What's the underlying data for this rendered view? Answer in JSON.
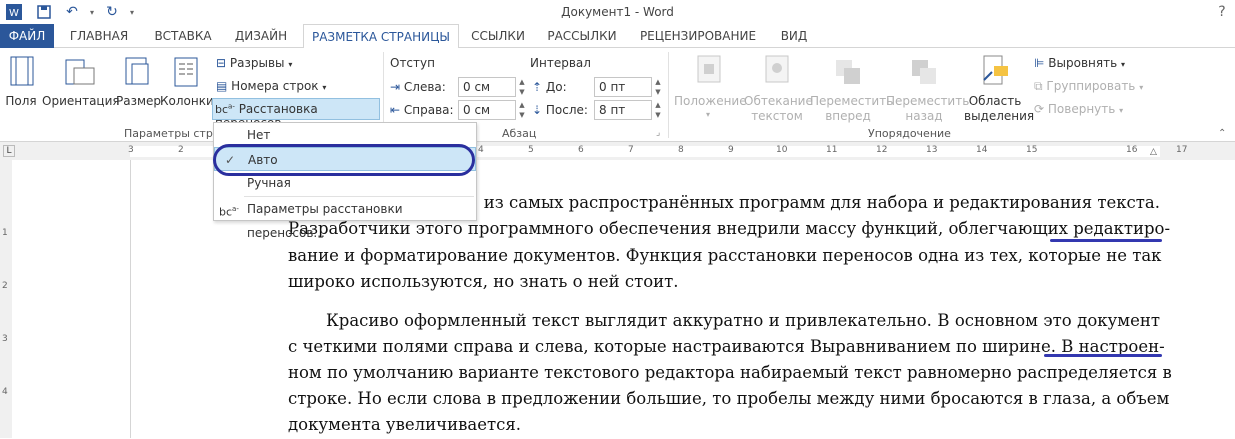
{
  "window": {
    "title": "Документ1 - Word"
  },
  "quick_access": {
    "save_icon": "save-icon",
    "undo_icon": "undo-icon",
    "redo_icon": "redo-icon"
  },
  "tabs": [
    {
      "label": "ФАЙЛ"
    },
    {
      "label": "ГЛАВНАЯ"
    },
    {
      "label": "ВСТАВКА"
    },
    {
      "label": "ДИЗАЙН"
    },
    {
      "label": "РАЗМЕТКА СТРАНИЦЫ"
    },
    {
      "label": "ССЫЛКИ"
    },
    {
      "label": "РАССЫЛКИ"
    },
    {
      "label": "РЕЦЕНЗИРОВАНИЕ"
    },
    {
      "label": "ВИД"
    }
  ],
  "page_setup": {
    "group_label": "Параметры стра",
    "margins": "Поля",
    "orientation": "Ориентация",
    "size": "Размер",
    "columns": "Колонки",
    "breaks": "Разрывы",
    "line_numbers": "Номера строк",
    "hyphenation": "Расстановка переносов"
  },
  "paragraph": {
    "group_label": "Абзац",
    "indent_label": "Отступ",
    "spacing_label": "Интервал",
    "left_label": "Слева:",
    "left_value": "0 см",
    "right_label": "Справа:",
    "right_value": "0 см",
    "before_label": "До:",
    "before_value": "0 пт",
    "after_label": "После:",
    "after_value": "8 пт"
  },
  "arrange": {
    "group_label": "Упорядочение",
    "position": [
      "Положение"
    ],
    "wrap": [
      "Обтекание",
      "текстом"
    ],
    "forward": [
      "Переместить",
      "вперед"
    ],
    "backward": [
      "Переместить",
      "назад"
    ],
    "selection_pane": [
      "Область",
      "выделения"
    ],
    "align": "Выровнять",
    "group": "Группировать",
    "rotate": "Повернуть"
  },
  "hyphenation_menu": {
    "none": "Нет",
    "auto": "Авто",
    "manual": "Ручная",
    "options": "Параметры расстановки переносов..."
  },
  "ruler": {
    "h_numbers": [
      "3",
      "2",
      "1",
      "1",
      "2",
      "3",
      "4",
      "5",
      "6",
      "7",
      "8",
      "9",
      "10",
      "11",
      "12",
      "13",
      "14",
      "15",
      "16",
      "17"
    ],
    "v_numbers": [
      "1",
      "2",
      "3",
      "4"
    ]
  },
  "document": {
    "p1": [
      "из самых распространённых программ для набора и редактирования текста.",
      "Разработчики этого программного обеспечения внедрили массу функций, облегчающих редактиро-",
      "вание и форматирование документов. Функция расстановки переносов одна из тех, которые не так",
      "широко используются, но знать о ней стоит."
    ],
    "p2": [
      "Красиво оформленный текст выглядит аккуратно и привлекательно. В основном это документ",
      "с четкими полями справа и слева, которые настраиваются Выравниванием по ширине. В настроен-",
      "ном по умолчанию варианте текстового редактора набираемый текст равномерно распределяется в",
      "строке. Но если слова в предложении большие, то пробелы между ними бросаются в глаза, а объем",
      "документа увеличивается."
    ]
  },
  "colors": {
    "accent": "#2b579a",
    "annotation": "#2a2f9e",
    "menu_highlight": "#cde6f7"
  }
}
